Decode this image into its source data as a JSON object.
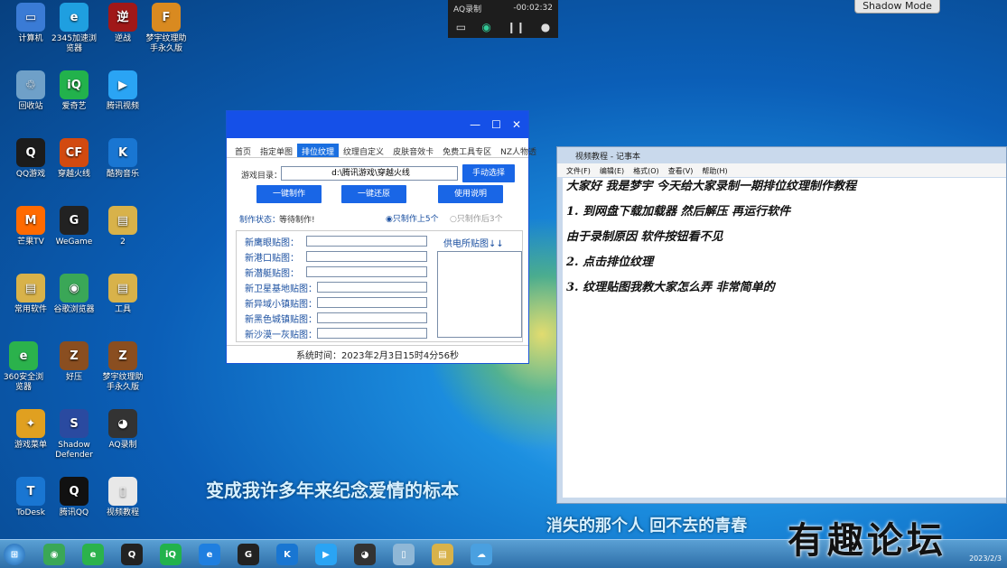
{
  "desktop": {
    "icons": [
      {
        "label": "计算机",
        "glyph": "▭",
        "color": "#3a7bd5"
      },
      {
        "label": "2345加速浏览器",
        "glyph": "e",
        "color": "#1f9fe0"
      },
      {
        "label": "逆战",
        "glyph": "逆",
        "color": "#a01818"
      },
      {
        "label": "梦宇纹理助手永久版",
        "glyph": "F",
        "color": "#d98a20"
      },
      {
        "label": "回收站",
        "glyph": "♲",
        "color": "#6fa0c8"
      },
      {
        "label": "爱奇艺",
        "glyph": "iQ",
        "color": "#22b24c"
      },
      {
        "label": "腾讯视频",
        "glyph": "▶",
        "color": "#2aa4f4"
      },
      {
        "label": "QQ游戏",
        "glyph": "Q",
        "color": "#1c1c1c"
      },
      {
        "label": "穿越火线",
        "glyph": "CF",
        "color": "#d24a10"
      },
      {
        "label": "酷狗音乐",
        "glyph": "K",
        "color": "#1976d2"
      },
      {
        "label": "芒果TV",
        "glyph": "M",
        "color": "#ff6a00"
      },
      {
        "label": "WeGame",
        "glyph": "G",
        "color": "#222"
      },
      {
        "label": "2",
        "glyph": "▤",
        "color": "#d8b24a"
      },
      {
        "label": "常用软件",
        "glyph": "▤",
        "color": "#d8b24a"
      },
      {
        "label": "谷歌浏览器",
        "glyph": "◉",
        "color": "#3aa757"
      },
      {
        "label": "工具",
        "glyph": "▤",
        "color": "#d8b24a"
      },
      {
        "label": "360安全浏览器",
        "glyph": "e",
        "color": "#2bb24c"
      },
      {
        "label": "好压",
        "glyph": "Z",
        "color": "#8a4e20"
      },
      {
        "label": "梦宇纹理助手永久版",
        "glyph": "Z",
        "color": "#8a4e20"
      },
      {
        "label": "游戏菜单",
        "glyph": "✦",
        "color": "#e0a020"
      },
      {
        "label": "Shadow Defender",
        "glyph": "S",
        "color": "#2a4aa0"
      },
      {
        "label": "AQ录制",
        "glyph": "◕",
        "color": "#333"
      },
      {
        "label": "ToDesk",
        "glyph": "T",
        "color": "#1976d2"
      },
      {
        "label": "腾讯QQ",
        "glyph": "Q",
        "color": "#111"
      },
      {
        "label": "视频教程",
        "glyph": "▯",
        "color": "#e8e8e8"
      }
    ]
  },
  "recorder": {
    "app": "AQ录制",
    "time": "-00:02:32"
  },
  "shadow_mode": "Shadow Mode",
  "app": {
    "tabs": [
      "首页",
      "指定单图",
      "排位纹理",
      "纹理自定义",
      "皮肤音效卡",
      "免费工具专区",
      "NZ人物透"
    ],
    "active_tab": 2,
    "game_dir_label": "游戏目录：",
    "game_dir_value": "d:\\腾讯游戏\\穿越火线",
    "manual_select": "手动选择",
    "btn_make": "一键制作",
    "btn_restore": "一键还原",
    "btn_help": "使用说明",
    "status_label": "制作状态：",
    "status_value": "等待制作!",
    "radio1": "只制作上5个",
    "radio2": "只制作后3个",
    "fields": [
      "新鹰眼贴图：",
      "新港口贴图：",
      "新潜艇贴图：",
      "新卫星基地贴图：",
      "新异域小镇贴图：",
      "新黑色城镇贴图：",
      "新沙漠一灰贴图："
    ],
    "power_label": "供电所贴图↓↓",
    "system_time": "系统时间：2023年2月3日15时4分56秒"
  },
  "notepad": {
    "title": "视频教程 - 记事本",
    "menu": [
      "文件(F)",
      "编辑(E)",
      "格式(O)",
      "查看(V)",
      "帮助(H)"
    ],
    "lines": [
      "大家好  我是梦宇  今天给大家录制一期排位纹理制作教程",
      "1. 到网盘下载加载器  然后解压  再运行软件",
      "由于录制原因  软件按钮看不见",
      "2. 点击排位纹理",
      "3. 纹理贴图我教大家怎么弄  非常简单的"
    ]
  },
  "subtitles": {
    "line1": "变成我许多年来纪念爱情的标本",
    "line2": "消失的那个人  回不去的青春"
  },
  "watermark": "有趣论坛",
  "taskbar": {
    "apps": [
      {
        "name": "chrome",
        "glyph": "◉",
        "color": "#3aa757"
      },
      {
        "name": "360",
        "glyph": "e",
        "color": "#2bb24c"
      },
      {
        "name": "qq-game",
        "glyph": "Q",
        "color": "#222"
      },
      {
        "name": "iqiyi",
        "glyph": "iQ",
        "color": "#22b24c"
      },
      {
        "name": "ie",
        "glyph": "e",
        "color": "#1f7fe0"
      },
      {
        "name": "wegame",
        "glyph": "G",
        "color": "#222"
      },
      {
        "name": "kugou",
        "glyph": "K",
        "color": "#1976d2"
      },
      {
        "name": "tencent-video",
        "glyph": "▶",
        "color": "#2aa4f4"
      },
      {
        "name": "aq",
        "glyph": "◕",
        "color": "#333"
      },
      {
        "name": "notepad",
        "glyph": "▯",
        "color": "#8fb7d6"
      },
      {
        "name": "explorer",
        "glyph": "▤",
        "color": "#d8b24a"
      },
      {
        "name": "cloud",
        "glyph": "☁",
        "color": "#4aa0e0"
      }
    ],
    "date": "2023/2/3"
  }
}
